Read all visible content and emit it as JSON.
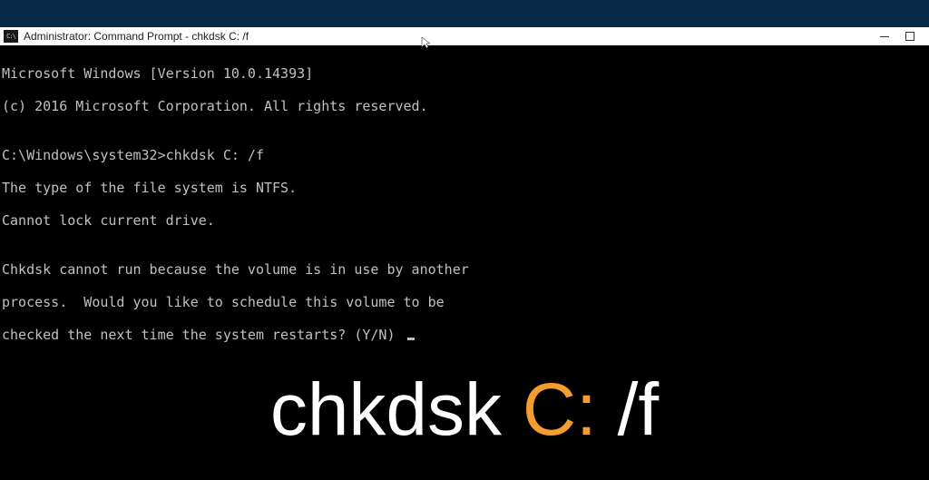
{
  "titlebar": {
    "title": "Administrator: Command Prompt - chkdsk C: /f"
  },
  "terminal": {
    "line0": "Microsoft Windows [Version 10.0.14393]",
    "line1": "(c) 2016 Microsoft Corporation. All rights reserved.",
    "blank1": "",
    "prompt_line": "C:\\Windows\\system32>chkdsk C: /f",
    "line2": "The type of the file system is NTFS.",
    "line3": "Cannot lock current drive.",
    "blank2": "",
    "line4": "Chkdsk cannot run because the volume is in use by another",
    "line5": "process.  Would you like to schedule this volume to be",
    "line6_prefix": "checked the next time the system restarts? (Y/N) "
  },
  "overlay": {
    "part1": "chkdsk ",
    "part2": "C:",
    "part3": " /f"
  }
}
